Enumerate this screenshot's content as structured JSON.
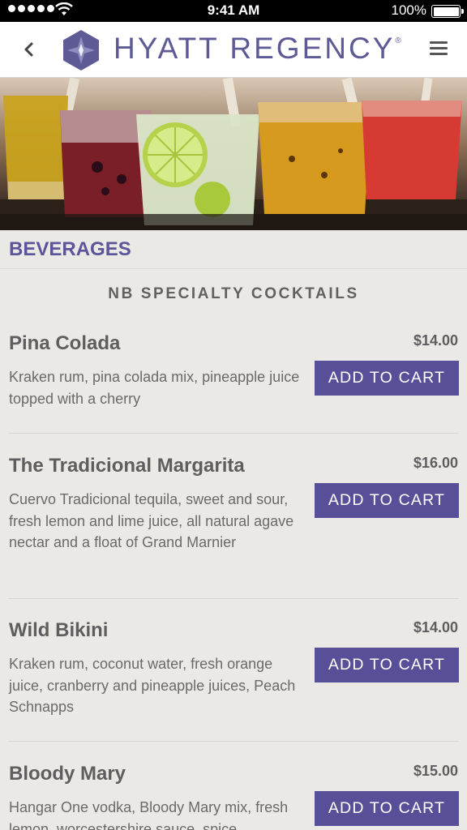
{
  "status_bar": {
    "time": "9:41 AM",
    "battery_percent": "100%",
    "signal_bars": 5
  },
  "header": {
    "brand": "HYATT REGENCY",
    "brand_mark": "®",
    "icons": [
      "back-chevron-icon",
      "hyatt-logo-icon",
      "hamburger-menu-icon"
    ],
    "colors": {
      "brand": "#5d5a96"
    }
  },
  "section": {
    "title": "BEVERAGES"
  },
  "category": {
    "title": "NB SPECIALTY COCKTAILS"
  },
  "items": [
    {
      "name": "Pina Colada",
      "price": "$14.00",
      "description": "Kraken rum, pina colada mix, pineapple juice topped with a cherry",
      "button": "ADD TO CART"
    },
    {
      "name": "The Tradicional Margarita",
      "price": "$16.00",
      "description": "Cuervo Tradicional tequila, sweet and sour, fresh lemon and lime juice, all natural agave nectar and a float of Grand Marnier",
      "button": "ADD TO CART"
    },
    {
      "name": "Wild Bikini",
      "price": "$14.00",
      "description": "Kraken rum, coconut water, fresh orange juice, cranberry and pineapple juices, Peach Schnapps",
      "button": "ADD TO CART"
    },
    {
      "name": "Bloody Mary",
      "price": "$15.00",
      "description": "Hangar One vodka, Bloody Mary mix, fresh lemon, worcestershire sauce, spice",
      "button": "ADD TO CART"
    }
  ],
  "colors": {
    "accent": "#574f98",
    "section_title": "#5d5599",
    "background": "#ebe9e6"
  }
}
